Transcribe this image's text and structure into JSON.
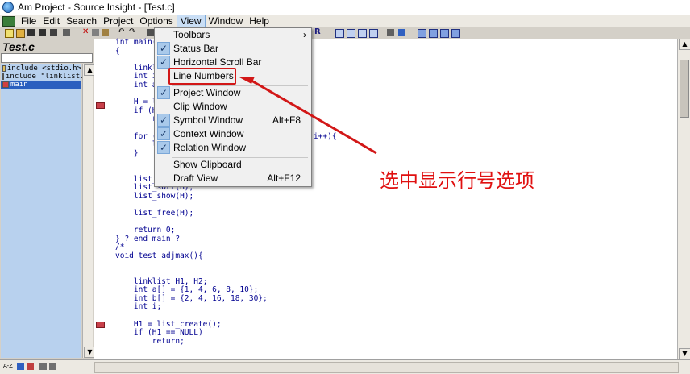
{
  "window": {
    "title": "Am Project - Source Insight - [Test.c]"
  },
  "menubar": {
    "items": [
      {
        "label": "File"
      },
      {
        "label": "Edit"
      },
      {
        "label": "Search"
      },
      {
        "label": "Project"
      },
      {
        "label": "Options"
      },
      {
        "label": "View"
      },
      {
        "label": "Window"
      },
      {
        "label": "Help"
      }
    ],
    "active_index": 5
  },
  "symbol_window": {
    "title": "Test.c",
    "items": [
      {
        "label": "include <stdio.h>"
      },
      {
        "label": "include \"linklist.h\""
      },
      {
        "label": "main"
      }
    ],
    "selected_index": 2
  },
  "view_menu": {
    "items": [
      {
        "label": "Toolbars",
        "checked": false,
        "shortcut": "",
        "submenu": true
      },
      {
        "label": "Status Bar",
        "checked": true,
        "shortcut": ""
      },
      {
        "label": "Horizontal Scroll Bar",
        "checked": true,
        "shortcut": ""
      },
      {
        "label": "Line Numbers",
        "checked": false,
        "shortcut": "",
        "highlighted": true
      },
      {
        "label": "Project Window",
        "checked": true,
        "shortcut": ""
      },
      {
        "label": "Clip Window",
        "checked": false,
        "shortcut": ""
      },
      {
        "label": "Symbol Window",
        "checked": true,
        "shortcut": "Alt+F8"
      },
      {
        "label": "Context Window",
        "checked": true,
        "shortcut": ""
      },
      {
        "label": "Relation Window",
        "checked": true,
        "shortcut": ""
      },
      {
        "label": "Show Clipboard",
        "checked": false,
        "shortcut": ""
      },
      {
        "label": "Draft View",
        "checked": false,
        "shortcut": "Alt+F12"
      }
    ]
  },
  "editor": {
    "lines": [
      "int main(int argc, const char *argv[])",
      "{",
      "",
      "    linklist H;",
      "    int i;",
      "    int a[] = {15,4,3,7,9,0};",
      "",
      "    H = list_create();",
      "    if (H == NULL)",
      "        return;",
      "",
      "    for (i = 0; i < sizeof(a)/sizeof(int); i++){",
      "        list_tail_insert(H, a[i]);",
      "    }",
      "",
      "",
      "    list_show(H);",
      "    list_sort(H);",
      "    list_show(H);",
      "",
      "    list_free(H);",
      "",
      "    return 0;",
      "} ? end main ?",
      "/*",
      "void test_adjmax(){",
      "",
      "",
      "    linklist H1, H2;",
      "    int a[] = {1, 4, 6, 8, 10};",
      "    int b[] = {2, 4, 16, 18, 30};",
      "    int i;",
      "",
      "    H1 = list_create();",
      "    if (H1 == NULL)",
      "        return;"
    ]
  },
  "status": {
    "sort_label": "A-Z"
  },
  "annotation": {
    "text": "选中显示行号选项"
  },
  "colors": {
    "accent_red": "#d21717",
    "menu_check": "#a9c9ea",
    "symbol_bg": "#b8d1ee"
  }
}
